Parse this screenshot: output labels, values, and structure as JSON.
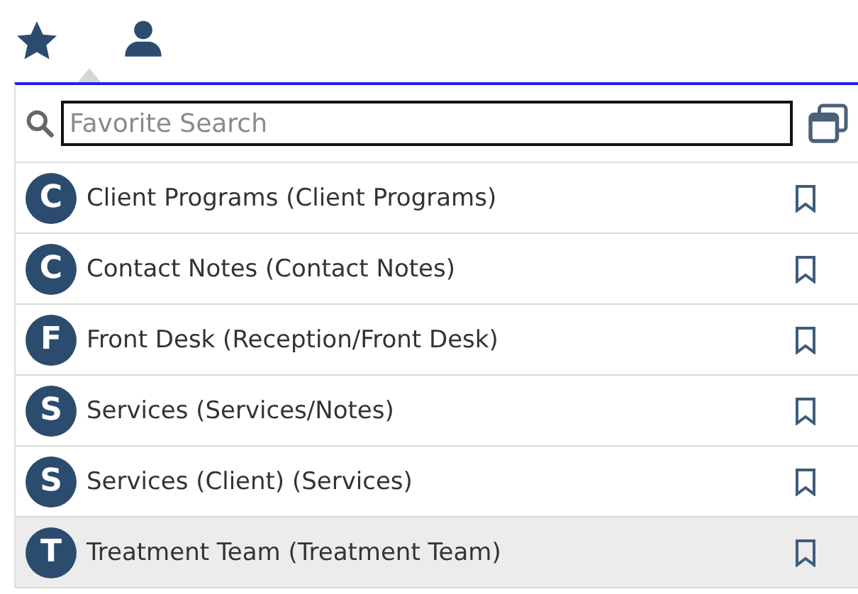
{
  "search": {
    "placeholder": "Favorite Search"
  },
  "favorites": [
    {
      "badge": "C",
      "label": "Client Programs (Client Programs)",
      "selected": false
    },
    {
      "badge": "C",
      "label": "Contact Notes (Contact Notes)",
      "selected": false
    },
    {
      "badge": "F",
      "label": "Front Desk (Reception/Front Desk)",
      "selected": false
    },
    {
      "badge": "S",
      "label": "Services (Services/Notes)",
      "selected": false
    },
    {
      "badge": "S",
      "label": "Services (Client) (Services)",
      "selected": false
    },
    {
      "badge": "T",
      "label": "Treatment Team (Treatment Team)",
      "selected": true
    }
  ]
}
